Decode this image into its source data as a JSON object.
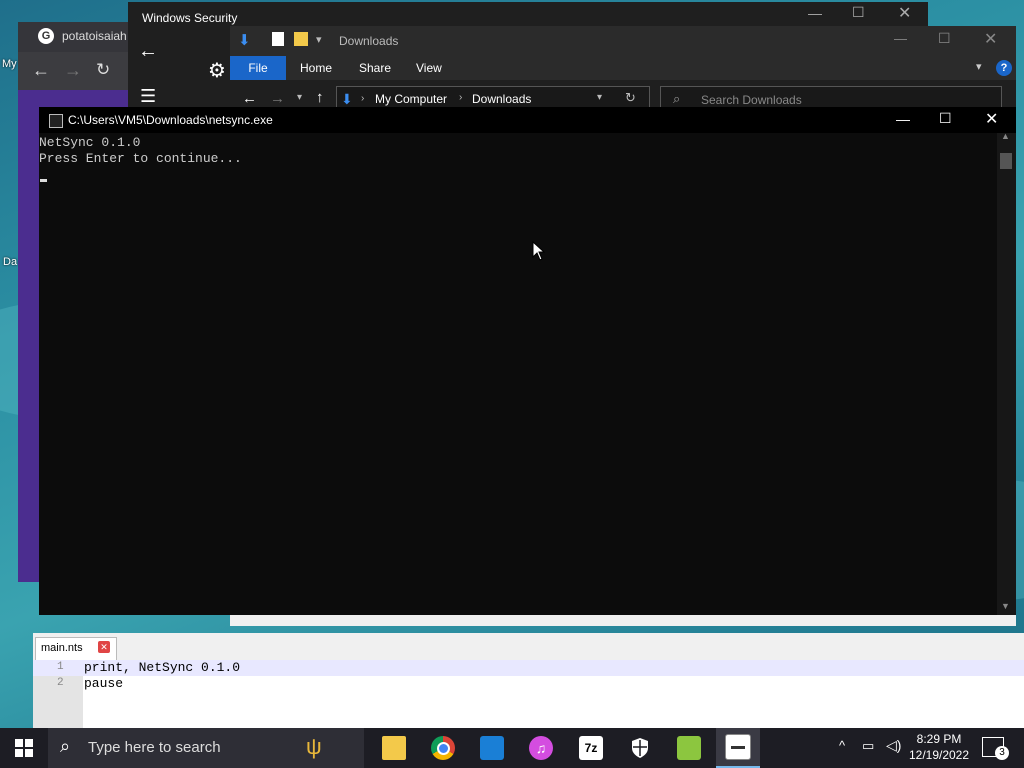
{
  "desktop": {
    "icons": [
      {
        "label": "My"
      },
      {
        "label": "Da"
      }
    ]
  },
  "chrome": {
    "tab_title": "potatoisaiah"
  },
  "security": {
    "title": "Windows Security"
  },
  "explorer": {
    "title": "Downloads",
    "ribbon_tabs": [
      "File",
      "Home",
      "Share",
      "View"
    ],
    "breadcrumb": [
      "My Computer",
      "Downloads"
    ],
    "search_placeholder": "Search Downloads"
  },
  "console": {
    "title": "C:\\Users\\VM5\\Downloads\\netsync.exe",
    "lines": [
      "NetSync 0.1.0",
      "Press Enter to continue..."
    ]
  },
  "editor": {
    "tab_label": "main.nts",
    "lines": [
      {
        "num": "1",
        "text": "print, NetSync 0.1.0"
      },
      {
        "num": "2",
        "text": "pause"
      }
    ]
  },
  "taskbar": {
    "search_placeholder": "Type here to search",
    "time": "8:29 PM",
    "date": "12/19/2022",
    "notification_count": "3",
    "apps": [
      {
        "icon": "menorah-icon"
      },
      {
        "icon": "file-explorer-icon"
      },
      {
        "icon": "chrome-icon"
      },
      {
        "icon": "store-icon"
      },
      {
        "icon": "itunes-icon",
        "label": "♫"
      },
      {
        "icon": "7zip-icon",
        "label": "7z"
      },
      {
        "icon": "security-shield-icon"
      },
      {
        "icon": "notepad-icon"
      },
      {
        "icon": "console-icon"
      }
    ]
  },
  "colors": {
    "accent": "#0a64c8",
    "console_bg": "#0c0c0c",
    "taskbar": "#1d1d24"
  }
}
